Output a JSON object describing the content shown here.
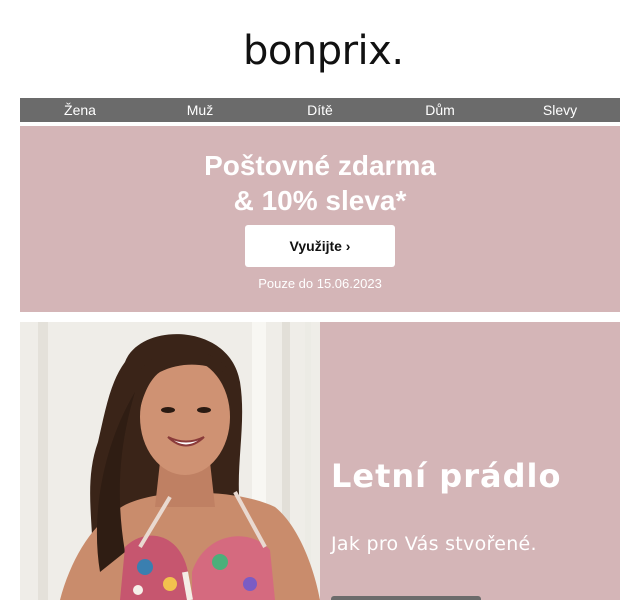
{
  "brand": {
    "logo_text": "bonprix",
    "logo_dot": "."
  },
  "nav": {
    "items": [
      {
        "label": "Žena"
      },
      {
        "label": "Muž"
      },
      {
        "label": "Dítě"
      },
      {
        "label": "Dům"
      },
      {
        "label": "Slevy"
      }
    ]
  },
  "promo": {
    "title_line1": "Poštovné zdarma",
    "title_line2": "& 10% sleva*",
    "button_label": "Využijte ›",
    "note": "Pouze do 15.06.2023"
  },
  "hero": {
    "title": "Letní prádlo",
    "subtitle": "Jak pro Vás stvořené.",
    "image_alt": "woman-in-floral-bra-photo"
  },
  "colors": {
    "nav_bg": "#6b6b6b",
    "promo_bg": "#d4b5b7",
    "text_light": "#ffffff"
  }
}
